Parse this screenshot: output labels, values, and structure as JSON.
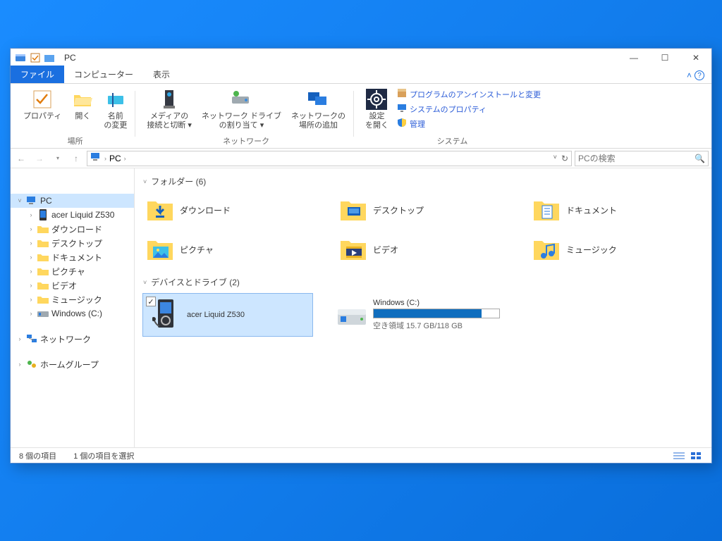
{
  "window": {
    "title": "PC",
    "minimize": "—",
    "maximize": "☐",
    "close": "✕"
  },
  "tabs": {
    "file": "ファイル",
    "computer": "コンピューター",
    "view": "表示"
  },
  "ribbon": {
    "properties": "プロパティ",
    "open": "開く",
    "rename": "名前\nの変更",
    "media": "メディアの\n接続と切断 ▾",
    "map_drive": "ネットワーク ドライブ\nの割り当て ▾",
    "add_location": "ネットワークの\n場所の追加",
    "settings": "設定\nを開く",
    "uninstall": "プログラムのアンインストールと変更",
    "sysprop": "システムのプロパティ",
    "manage": "管理",
    "group_location": "場所",
    "group_network": "ネットワーク",
    "group_system": "システム"
  },
  "breadcrumb": {
    "root": "PC",
    "search_placeholder": "PCの検索"
  },
  "sidebar": {
    "pc": "PC",
    "items": [
      "acer Liquid Z530",
      "ダウンロード",
      "デスクトップ",
      "ドキュメント",
      "ピクチャ",
      "ビデオ",
      "ミュージック",
      "Windows (C:)"
    ],
    "network": "ネットワーク",
    "homegroup": "ホームグループ"
  },
  "content": {
    "folders_header": "フォルダー (6)",
    "folders": [
      "ダウンロード",
      "デスクトップ",
      "ドキュメント",
      "ピクチャ",
      "ビデオ",
      "ミュージック"
    ],
    "devices_header": "デバイスとドライブ (2)",
    "device_phone": "acer Liquid Z530",
    "drive_c_name": "Windows (C:)",
    "drive_c_caption": "空き領域 15.7 GB/118 GB",
    "drive_c_used_percent": 86
  },
  "status": {
    "items": "8 個の項目",
    "selected": "1 個の項目を選択"
  }
}
